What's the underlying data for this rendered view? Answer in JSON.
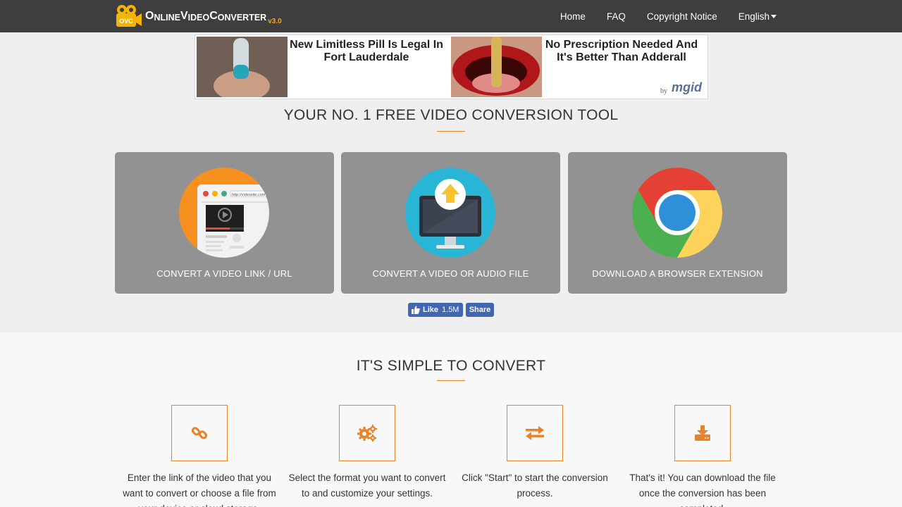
{
  "navbar": {
    "logo": {
      "text_big1": "O",
      "text_small1": "NLINE",
      "text_big2": "V",
      "text_small2": "IDEO",
      "text_big3": "C",
      "text_small3": "ONVERTER",
      "version": "v3.0",
      "badge": "OVC"
    },
    "links": [
      "Home",
      "FAQ",
      "Copyright Notice",
      "English"
    ]
  },
  "ad": {
    "headline1": "New Limitless Pill Is Legal In Fort Lauderdale",
    "headline2": "No Prescription Needed And It's Better Than Adderall",
    "by": "by",
    "brand": "mgid"
  },
  "hero": {
    "title": "YOUR NO. 1 FREE VIDEO CONVERSION TOOL"
  },
  "cards": [
    {
      "label": "CONVERT A VIDEO LINK / URL",
      "icon": "browser-video-icon",
      "url_text": "http://videosite.com"
    },
    {
      "label": "CONVERT A VIDEO OR AUDIO FILE",
      "icon": "monitor-upload-icon"
    },
    {
      "label": "DOWNLOAD A BROWSER EXTENSION",
      "icon": "chrome-icon"
    }
  ],
  "facebook": {
    "like": "Like",
    "count": "1.5M",
    "share": "Share"
  },
  "steps_section": {
    "title": "IT'S SIMPLE TO CONVERT",
    "steps": [
      {
        "icon": "link-icon",
        "text": "Enter the link of the video that you want to convert or choose a file from your device or cloud storage."
      },
      {
        "icon": "gears-icon",
        "text": "Select the format you want to convert to and customize your settings."
      },
      {
        "icon": "exchange-icon",
        "text": "Click \"Start\" to start the conversion process."
      },
      {
        "icon": "download-icon",
        "text": "That's it! You can download the file once the conversion has been completed."
      }
    ]
  },
  "colors": {
    "accent": "#e8832a",
    "navbar": "#3e3e3e",
    "card": "#929292",
    "fb": "#4267b2"
  }
}
